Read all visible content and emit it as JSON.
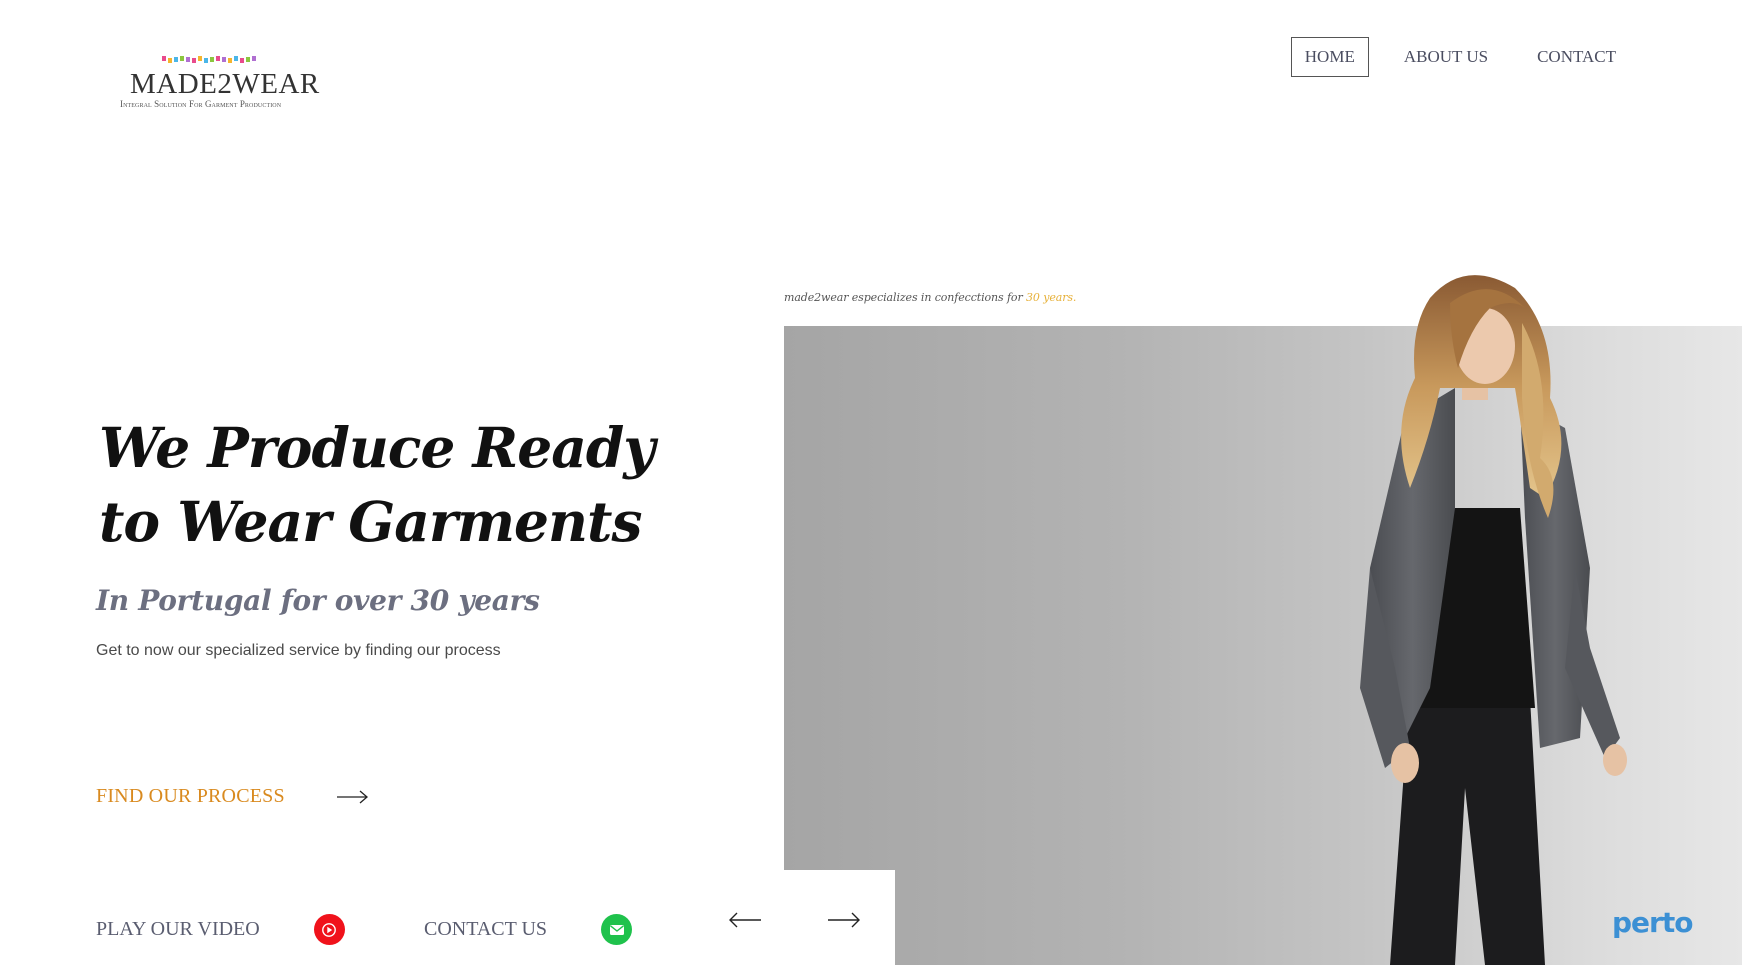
{
  "header": {
    "logo": {
      "wordmark": "MADE2WEAR",
      "tagline": "Integral Solution For Garment Production",
      "dot_colors": [
        "#e94b8c",
        "#f5b52e",
        "#4ab6e8",
        "#8cc63f",
        "#b06fd1",
        "#e94b8c",
        "#f5b52e",
        "#4ab6e8",
        "#8cc63f",
        "#e94b8c",
        "#b06fd1",
        "#f5b52e",
        "#4ab6e8",
        "#e94b8c",
        "#8cc63f",
        "#b06fd1"
      ]
    },
    "nav": {
      "items": [
        {
          "label": "HOME",
          "active": true
        },
        {
          "label": "ABOUT US",
          "active": false
        },
        {
          "label": "CONTACT",
          "active": false
        }
      ]
    }
  },
  "hero": {
    "title_line1": "We Produce Ready",
    "title_line2": "to Wear Garments",
    "subtitle": "In Portugal for over 30 years",
    "description": "Get to now our specialized service by finding our process",
    "cta_label": "FIND OUR PROCESS",
    "tagline_prefix": "made2wear especializes in confecctions for",
    "tagline_highlight": "30 years."
  },
  "bottom": {
    "video_label": "PLAY OUR VIDEO",
    "contact_label": "CONTACT US"
  },
  "icons": {
    "cta": "arrow-right-icon",
    "video": "play-icon",
    "contact": "mail-icon",
    "prev": "arrow-left-icon",
    "next": "arrow-right-icon"
  },
  "watermark": "perto",
  "colors": {
    "accent_orange": "#d98a1f",
    "tagline_yellow": "#e7b13a",
    "nav_text": "#4a4d60",
    "play_red": "#f0121b",
    "mail_green": "#1fc24c",
    "watermark_blue": "#3c90d4"
  }
}
